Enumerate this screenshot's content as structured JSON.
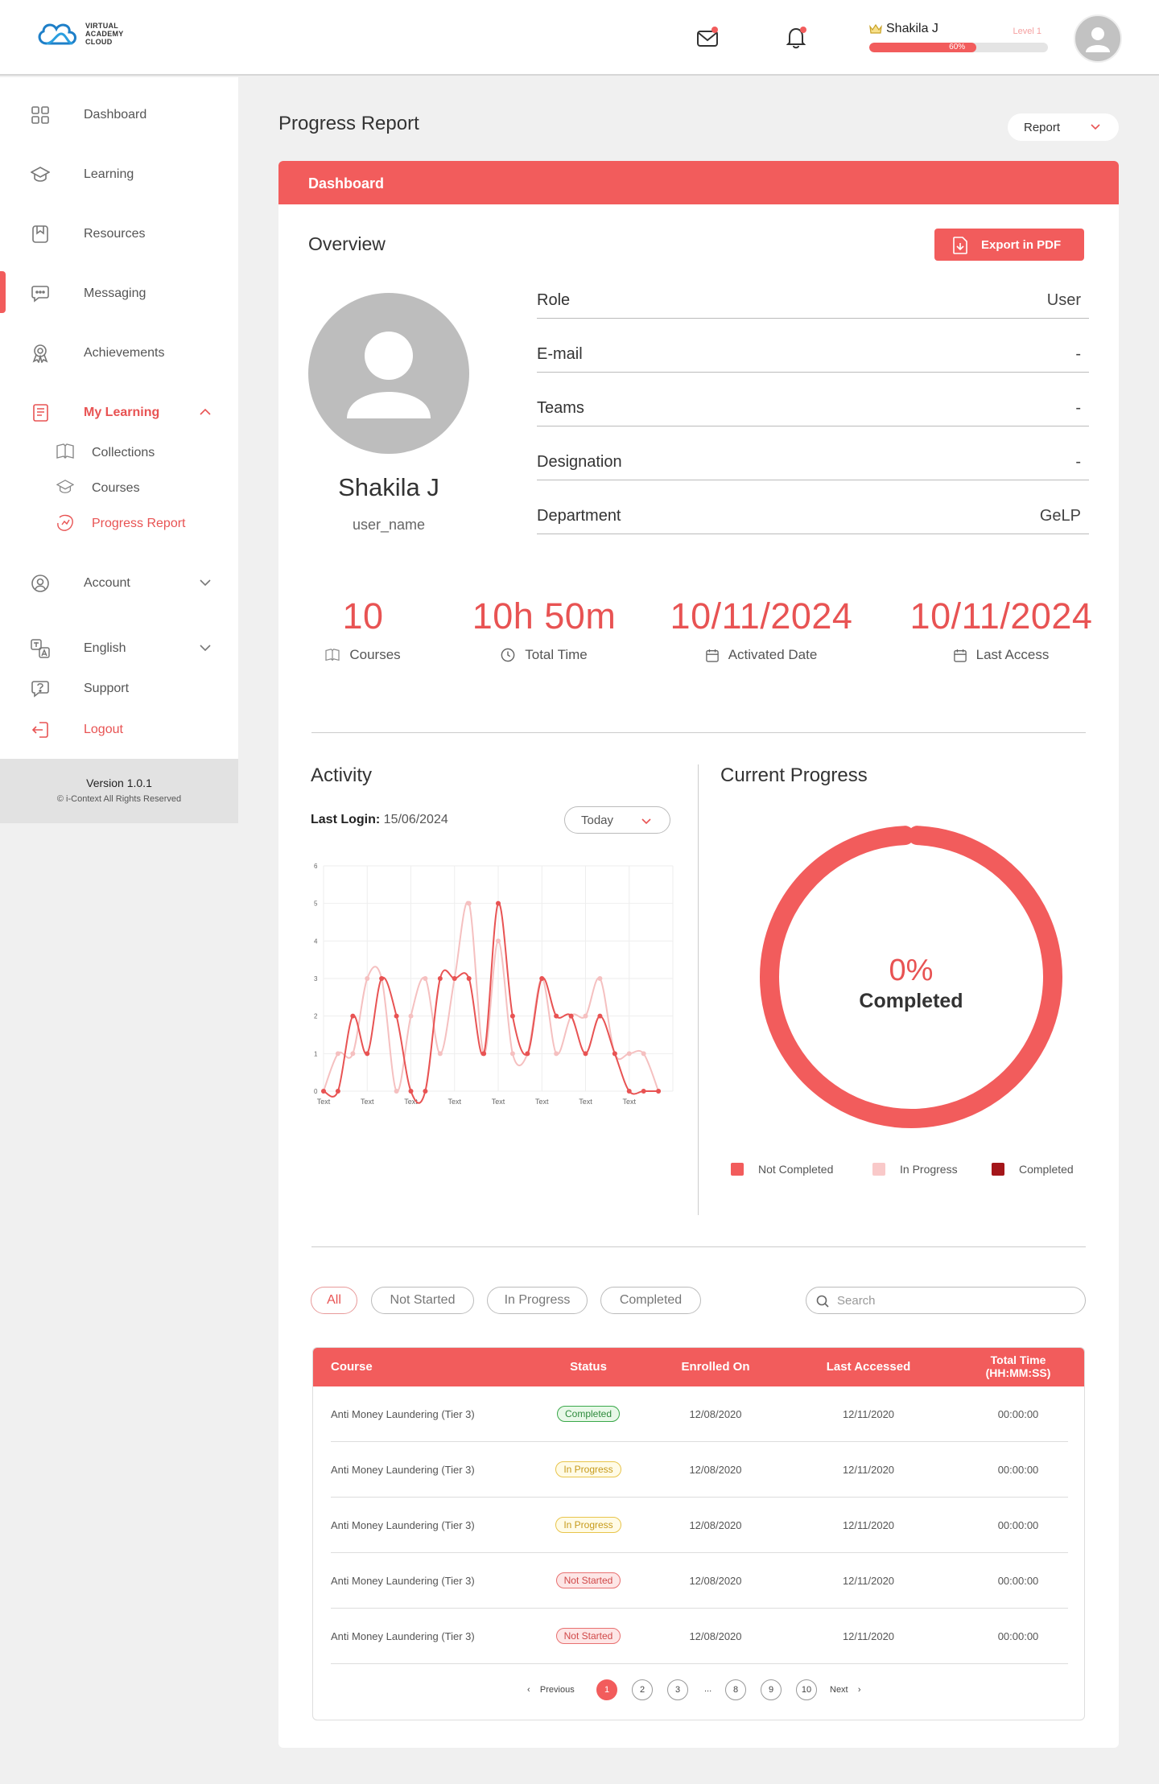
{
  "brand": {
    "line1": "VIRTUAL",
    "line2": "ACADEMY",
    "line3": "CLOUD"
  },
  "header": {
    "user_name": "Shakila J",
    "level": "Level 1",
    "progress_text": "60%",
    "progress_value": 60,
    "accent": "#f25c5c"
  },
  "sidebar": {
    "items": [
      {
        "label": "Dashboard",
        "icon": "grid-icon"
      },
      {
        "label": "Learning",
        "icon": "graduation-cap-icon"
      },
      {
        "label": "Resources",
        "icon": "bookmark-icon"
      },
      {
        "label": "Messaging",
        "icon": "chat-icon"
      },
      {
        "label": "Achievements",
        "icon": "award-icon"
      },
      {
        "label": "My Learning",
        "icon": "notebook-icon"
      },
      {
        "label": "Account",
        "icon": "user-circle-icon"
      },
      {
        "label": "English",
        "icon": "language-icon"
      },
      {
        "label": "Support",
        "icon": "help-icon"
      },
      {
        "label": "Logout",
        "icon": "logout-icon"
      }
    ],
    "sub_items": [
      {
        "label": "Collections",
        "icon": "book-open-icon"
      },
      {
        "label": "Courses",
        "icon": "graduation-cap-icon"
      },
      {
        "label": "Progress Report",
        "icon": "progress-report-icon"
      }
    ],
    "version": "Version 1.0.1",
    "copyright": "© i-Context All Rights Reserved"
  },
  "page": {
    "title": "Progress Report",
    "report_select": "Report"
  },
  "card": {
    "header": "Dashboard",
    "overview_title": "Overview",
    "export_label": "Export in PDF"
  },
  "profile": {
    "name": "Shakila J",
    "username": "user_name",
    "fields": [
      {
        "key": "Role",
        "value": "User"
      },
      {
        "key": "E-mail",
        "value": "-"
      },
      {
        "key": "Teams",
        "value": "-"
      },
      {
        "key": "Designation",
        "value": "-"
      },
      {
        "key": "Department",
        "value": "GeLP"
      }
    ]
  },
  "stats": [
    {
      "value": "10",
      "label": "Courses",
      "icon": "book-icon"
    },
    {
      "value": "10h 50m",
      "label": "Total Time",
      "icon": "clock-icon"
    },
    {
      "value": "10/11/2024",
      "label": "Activated Date",
      "icon": "calendar-icon"
    },
    {
      "value": "10/11/2024",
      "label": "Last Access",
      "icon": "calendar-icon"
    }
  ],
  "activity": {
    "title": "Activity",
    "last_login_label": "Last Login:",
    "last_login_value": "15/06/2024",
    "period": "Today"
  },
  "chart_data": {
    "type": "line",
    "categories": [
      "Text",
      "Text",
      "Text",
      "Text",
      "Text",
      "Text",
      "Text",
      "Text"
    ],
    "x": [
      0,
      0.33,
      0.67,
      1,
      1.33,
      1.67,
      2,
      2.33,
      2.67,
      3,
      3.33,
      3.67,
      4,
      4.33,
      4.67,
      5,
      5.33,
      5.67,
      6,
      6.33,
      6.67,
      7,
      7.33,
      7.67
    ],
    "yticks": [
      0,
      1,
      2,
      3,
      4,
      5,
      6
    ],
    "ylim": [
      0,
      6
    ],
    "grid": true,
    "series": [
      {
        "color": "#f5c0c0",
        "values": [
          0,
          1,
          1,
          3,
          3,
          0,
          2,
          3,
          1,
          3,
          5,
          1,
          4,
          1,
          1,
          3,
          1,
          2,
          2,
          3,
          1,
          1,
          1,
          0
        ]
      },
      {
        "color": "#e85353",
        "values": [
          0,
          0,
          2,
          1,
          3,
          2,
          0,
          0,
          3,
          3,
          3,
          1,
          5,
          2,
          1,
          3,
          2,
          2,
          1,
          2,
          1,
          0,
          0,
          0
        ]
      }
    ]
  },
  "current_progress": {
    "title": "Current Progress",
    "percent_text": "0%",
    "completed_label": "Completed",
    "values": {
      "not_completed": 100,
      "in_progress": 0,
      "completed": 0
    },
    "legend": [
      {
        "label": "Not Completed",
        "color": "#f25c5c"
      },
      {
        "label": "In Progress",
        "color": "#f9c9c9"
      },
      {
        "label": "Completed",
        "color": "#a4161a"
      }
    ]
  },
  "filters": [
    "All",
    "Not Started",
    "In Progress",
    "Completed"
  ],
  "search": {
    "placeholder": "Search"
  },
  "table": {
    "headers": [
      "Course",
      "Status",
      "Enrolled On",
      "Last Accessed",
      "Total Time",
      "(HH:MM:SS)"
    ],
    "rows": [
      {
        "course": "Anti Money Laundering (Tier 3)",
        "status": "Completed",
        "enrolled": "12/08/2020",
        "accessed": "12/11/2020",
        "time": "00:00:00"
      },
      {
        "course": "Anti Money Laundering (Tier 3)",
        "status": "In Progress",
        "enrolled": "12/08/2020",
        "accessed": "12/11/2020",
        "time": "00:00:00"
      },
      {
        "course": "Anti Money Laundering (Tier 3)",
        "status": "In Progress",
        "enrolled": "12/08/2020",
        "accessed": "12/11/2020",
        "time": "00:00:00"
      },
      {
        "course": "Anti Money Laundering (Tier 3)",
        "status": "Not Started",
        "enrolled": "12/08/2020",
        "accessed": "12/11/2020",
        "time": "00:00:00"
      },
      {
        "course": "Anti Money Laundering (Tier 3)",
        "status": "Not Started",
        "enrolled": "12/08/2020",
        "accessed": "12/11/2020",
        "time": "00:00:00"
      }
    ]
  },
  "pagination": {
    "previous": "Previous",
    "next": "Next",
    "pages": [
      "1",
      "2",
      "3",
      "...",
      "8",
      "9",
      "10"
    ],
    "current": "1"
  }
}
